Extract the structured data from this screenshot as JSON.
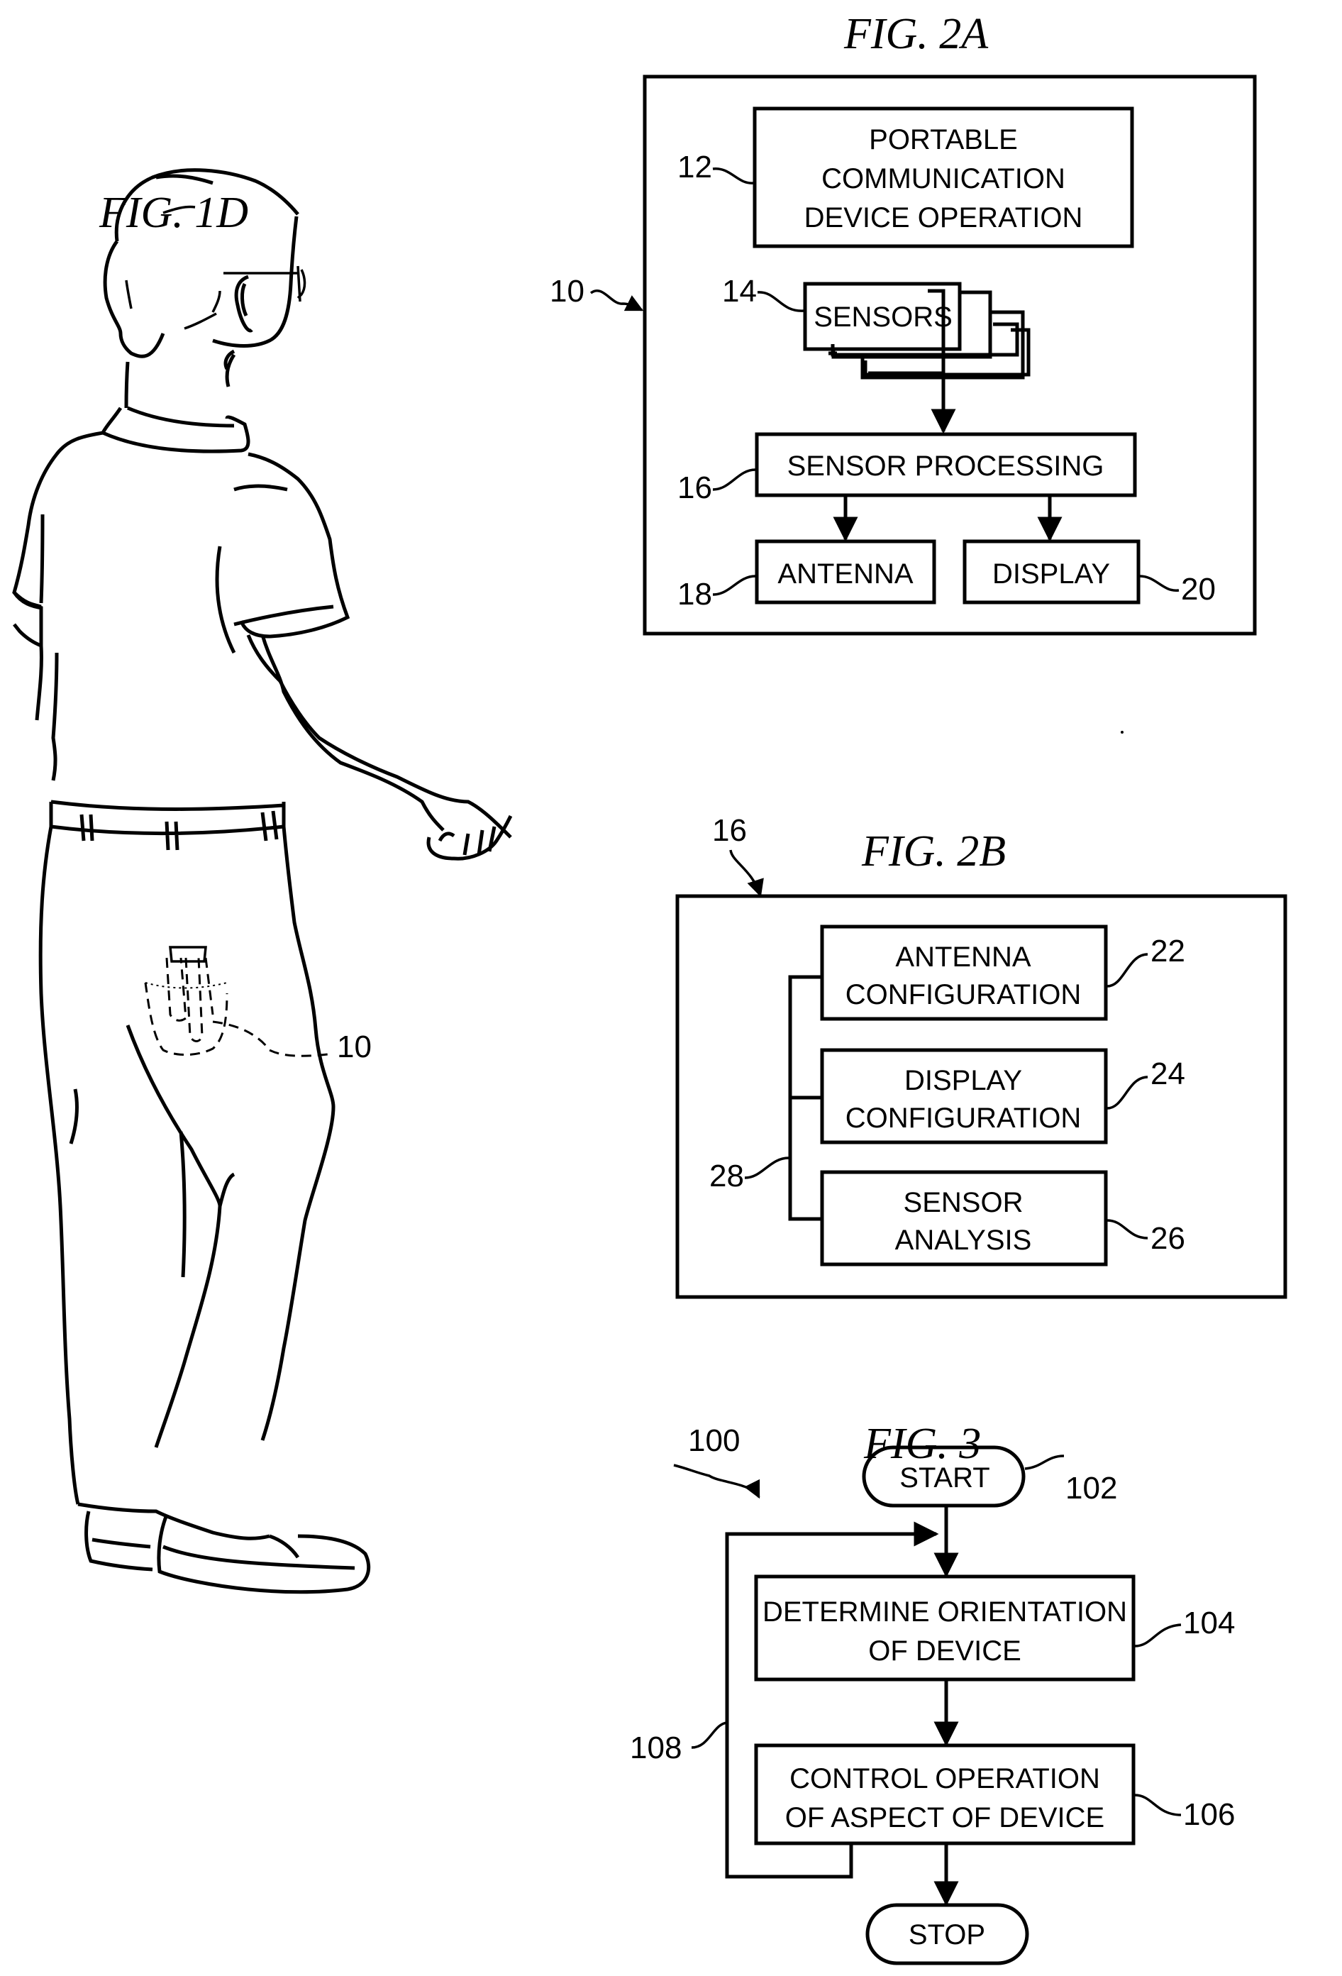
{
  "sheet": {
    "figures": {
      "fig1d": {
        "title": "FIG. 1D",
        "subject": "person-walking-with-device-in-back-pocket",
        "device_ref": "10"
      },
      "fig2a": {
        "title": "FIG. 2A",
        "outer_ref": "10",
        "blocks": [
          {
            "id": "portable-communication-device-operation",
            "ref": "12",
            "lines": [
              "PORTABLE",
              "COMMUNICATION",
              "DEVICE OPERATION"
            ]
          },
          {
            "id": "sensors",
            "ref": "14",
            "lines": [
              "SENSORS"
            ]
          },
          {
            "id": "sensor-processing",
            "ref": "16",
            "lines": [
              "SENSOR PROCESSING"
            ]
          },
          {
            "id": "antenna",
            "ref": "18",
            "lines": [
              "ANTENNA"
            ]
          },
          {
            "id": "display",
            "ref": "20",
            "lines": [
              "DISPLAY"
            ]
          }
        ]
      },
      "fig2b": {
        "title": "FIG. 2B",
        "outer_ref": "16",
        "bus_ref": "28",
        "blocks": [
          {
            "id": "antenna-configuration",
            "ref": "22",
            "lines": [
              "ANTENNA",
              "CONFIGURATION"
            ]
          },
          {
            "id": "display-configuration",
            "ref": "24",
            "lines": [
              "DISPLAY",
              "CONFIGURATION"
            ]
          },
          {
            "id": "sensor-analysis",
            "ref": "26",
            "lines": [
              "SENSOR",
              "ANALYSIS"
            ]
          }
        ]
      },
      "fig3": {
        "title": "FIG. 3",
        "method_ref": "100",
        "loop_ref": "108",
        "steps": [
          {
            "id": "start",
            "ref": "102",
            "lines": [
              "START"
            ]
          },
          {
            "id": "determine-orientation",
            "ref": "104",
            "lines": [
              "DETERMINE ORIENTATION",
              "OF DEVICE"
            ]
          },
          {
            "id": "control-operation",
            "ref": "106",
            "lines": [
              "CONTROL OPERATION",
              "OF ASPECT OF DEVICE"
            ]
          },
          {
            "id": "stop",
            "ref": "",
            "lines": [
              "STOP"
            ]
          }
        ]
      }
    }
  }
}
